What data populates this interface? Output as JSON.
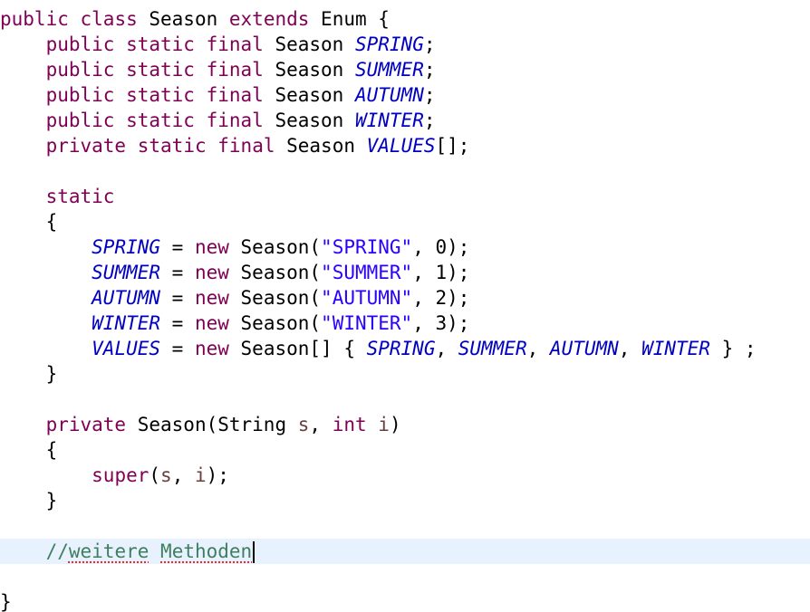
{
  "editor": {
    "language": "Java",
    "current_line_index": 21,
    "lines": [
      [
        {
          "t": "public",
          "c": "kw"
        },
        {
          "t": " "
        },
        {
          "t": "class",
          "c": "kw"
        },
        {
          "t": " Season "
        },
        {
          "t": "extends",
          "c": "kw"
        },
        {
          "t": " Enum {"
        }
      ],
      [
        {
          "t": "    "
        },
        {
          "t": "public",
          "c": "kw"
        },
        {
          "t": " "
        },
        {
          "t": "static",
          "c": "kw"
        },
        {
          "t": " "
        },
        {
          "t": "final",
          "c": "kw"
        },
        {
          "t": " Season "
        },
        {
          "t": "SPRING",
          "c": "field"
        },
        {
          "t": ";"
        }
      ],
      [
        {
          "t": "    "
        },
        {
          "t": "public",
          "c": "kw"
        },
        {
          "t": " "
        },
        {
          "t": "static",
          "c": "kw"
        },
        {
          "t": " "
        },
        {
          "t": "final",
          "c": "kw"
        },
        {
          "t": " Season "
        },
        {
          "t": "SUMMER",
          "c": "field"
        },
        {
          "t": ";"
        }
      ],
      [
        {
          "t": "    "
        },
        {
          "t": "public",
          "c": "kw"
        },
        {
          "t": " "
        },
        {
          "t": "static",
          "c": "kw"
        },
        {
          "t": " "
        },
        {
          "t": "final",
          "c": "kw"
        },
        {
          "t": " Season "
        },
        {
          "t": "AUTUMN",
          "c": "field"
        },
        {
          "t": ";"
        }
      ],
      [
        {
          "t": "    "
        },
        {
          "t": "public",
          "c": "kw"
        },
        {
          "t": " "
        },
        {
          "t": "static",
          "c": "kw"
        },
        {
          "t": " "
        },
        {
          "t": "final",
          "c": "kw"
        },
        {
          "t": " Season "
        },
        {
          "t": "WINTER",
          "c": "field"
        },
        {
          "t": ";"
        }
      ],
      [
        {
          "t": "    "
        },
        {
          "t": "private",
          "c": "kw"
        },
        {
          "t": " "
        },
        {
          "t": "static",
          "c": "kw"
        },
        {
          "t": " "
        },
        {
          "t": "final",
          "c": "kw"
        },
        {
          "t": " Season "
        },
        {
          "t": "VALUES",
          "c": "field"
        },
        {
          "t": "[];"
        }
      ],
      [],
      [
        {
          "t": "    "
        },
        {
          "t": "static",
          "c": "kw"
        }
      ],
      [
        {
          "t": "    {"
        }
      ],
      [
        {
          "t": "        "
        },
        {
          "t": "SPRING",
          "c": "field"
        },
        {
          "t": " = "
        },
        {
          "t": "new",
          "c": "kw"
        },
        {
          "t": " Season("
        },
        {
          "t": "\"SPRING\"",
          "c": "str"
        },
        {
          "t": ", 0);"
        }
      ],
      [
        {
          "t": "        "
        },
        {
          "t": "SUMMER",
          "c": "field"
        },
        {
          "t": " = "
        },
        {
          "t": "new",
          "c": "kw"
        },
        {
          "t": " Season("
        },
        {
          "t": "\"SUMMER\"",
          "c": "str"
        },
        {
          "t": ", 1);"
        }
      ],
      [
        {
          "t": "        "
        },
        {
          "t": "AUTUMN",
          "c": "field"
        },
        {
          "t": " = "
        },
        {
          "t": "new",
          "c": "kw"
        },
        {
          "t": " Season("
        },
        {
          "t": "\"AUTUMN\"",
          "c": "str"
        },
        {
          "t": ", 2);"
        }
      ],
      [
        {
          "t": "        "
        },
        {
          "t": "WINTER",
          "c": "field"
        },
        {
          "t": " = "
        },
        {
          "t": "new",
          "c": "kw"
        },
        {
          "t": " Season("
        },
        {
          "t": "\"WINTER\"",
          "c": "str"
        },
        {
          "t": ", 3);"
        }
      ],
      [
        {
          "t": "        "
        },
        {
          "t": "VALUES",
          "c": "field"
        },
        {
          "t": " = "
        },
        {
          "t": "new",
          "c": "kw"
        },
        {
          "t": " Season[] { "
        },
        {
          "t": "SPRING",
          "c": "field"
        },
        {
          "t": ", "
        },
        {
          "t": "SUMMER",
          "c": "field"
        },
        {
          "t": ", "
        },
        {
          "t": "AUTUMN",
          "c": "field"
        },
        {
          "t": ", "
        },
        {
          "t": "WINTER",
          "c": "field"
        },
        {
          "t": " } ;"
        }
      ],
      [
        {
          "t": "    }"
        }
      ],
      [],
      [
        {
          "t": "    "
        },
        {
          "t": "private",
          "c": "kw"
        },
        {
          "t": " Season(String "
        },
        {
          "t": "s",
          "c": "param"
        },
        {
          "t": ", "
        },
        {
          "t": "int",
          "c": "kw"
        },
        {
          "t": " "
        },
        {
          "t": "i",
          "c": "param"
        },
        {
          "t": ")"
        }
      ],
      [
        {
          "t": "    {"
        }
      ],
      [
        {
          "t": "        "
        },
        {
          "t": "super",
          "c": "kw"
        },
        {
          "t": "("
        },
        {
          "t": "s",
          "c": "param"
        },
        {
          "t": ", "
        },
        {
          "t": "i",
          "c": "param"
        },
        {
          "t": ");"
        }
      ],
      [
        {
          "t": "    }"
        }
      ],
      [],
      [
        {
          "t": "    "
        },
        {
          "t": "//",
          "c": "comment"
        },
        {
          "t": "weitere",
          "c": "comment spell"
        },
        {
          "t": " ",
          "c": "comment"
        },
        {
          "t": "Methoden",
          "c": "comment spell"
        },
        {
          "caret": true
        }
      ],
      [],
      [
        {
          "t": "}"
        }
      ]
    ]
  }
}
